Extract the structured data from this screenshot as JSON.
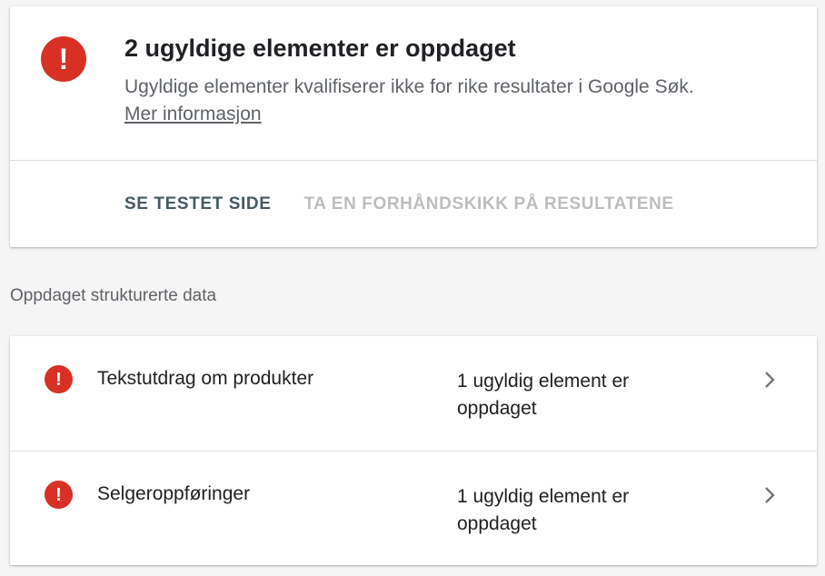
{
  "summary": {
    "icon": "error-icon",
    "icon_glyph": "!",
    "title": "2 ugyldige elementer er oppdaget",
    "description": "Ugyldige elementer kvalifiserer ikke for rike resultater i Google Søk.",
    "more_link": "Mer informasjon",
    "actions": {
      "view_tested_page": "SE TESTET SIDE",
      "preview_results": "TA EN FORHÅNDSKIKK PÅ RESULTATENE"
    }
  },
  "section": {
    "heading": "Oppdaget strukturerte data"
  },
  "items": [
    {
      "icon": "error-icon",
      "icon_glyph": "!",
      "name": "Tekstutdrag om produkter",
      "status": "1 ugyldig element er oppdaget",
      "chevron": "chevron-right-icon"
    },
    {
      "icon": "error-icon",
      "icon_glyph": "!",
      "name": "Selgeroppføringer",
      "status": "1 ugyldig element er oppdaget",
      "chevron": "chevron-right-icon"
    }
  ],
  "colors": {
    "error": "#d93025",
    "primary_action": "#455a64",
    "disabled_action": "#bdbdbd",
    "secondary_text": "#5f6368"
  }
}
